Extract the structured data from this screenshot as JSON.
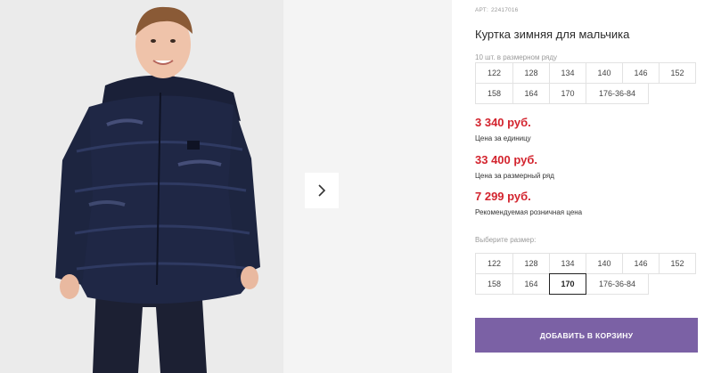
{
  "product": {
    "article_label": "АРТ:",
    "article_value": "22417016",
    "title": "Куртка зимняя для мальчика",
    "pack_note": "10 шт. в размерном ряду",
    "pack_sizes": [
      [
        "122",
        "128",
        "134",
        "140",
        "146",
        "152"
      ],
      [
        "158",
        "164",
        "170",
        "176-36-84"
      ]
    ]
  },
  "prices": [
    {
      "value": "3 340 руб.",
      "label": "Цена за единицу"
    },
    {
      "value": "33 400 руб.",
      "label": "Цена за размерный ряд"
    },
    {
      "value": "7 299 руб.",
      "label": "Рекомендуемая розничная цена"
    }
  ],
  "size_select": {
    "label": "Выберите размер:",
    "sizes": [
      [
        "122",
        "128",
        "134",
        "140",
        "146",
        "152"
      ],
      [
        "158",
        "164",
        "170",
        "176-36-84"
      ]
    ],
    "selected": "170"
  },
  "cart": {
    "button_label": "ДОБАВИТЬ В КОРЗИНУ"
  },
  "colors": {
    "price": "#d3242e",
    "accent_button": "#7b61a5",
    "jacket": "#1f2745"
  },
  "icons": {
    "next": "chevron-right-icon"
  }
}
